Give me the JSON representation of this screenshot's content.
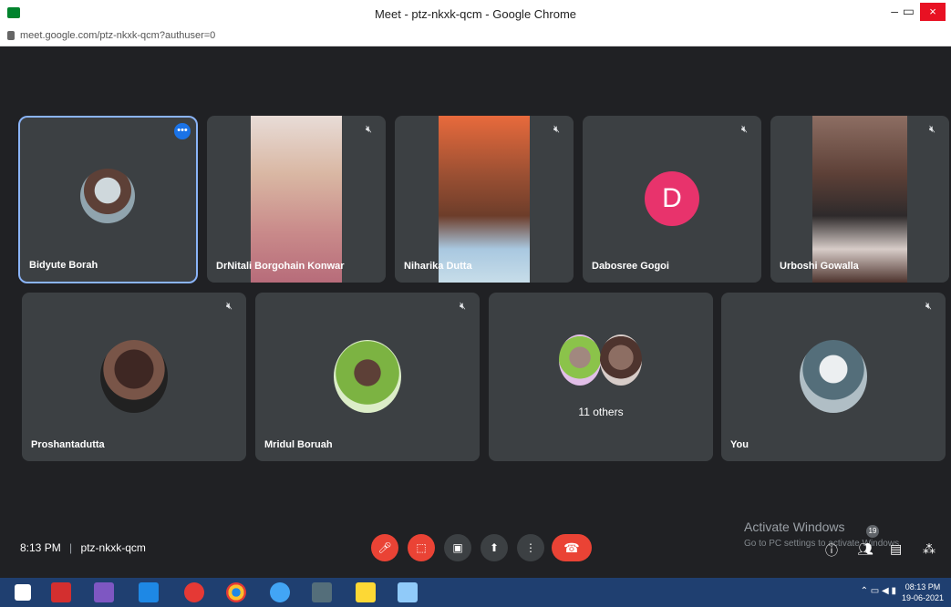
{
  "window": {
    "title": "Meet - ptz-nkxk-qcm - Google Chrome",
    "minimize": "–",
    "restore": "▭",
    "close": "×"
  },
  "address": {
    "url": "meet.google.com/ptz-nkxk-qcm?authuser=0"
  },
  "tiles": [
    {
      "name": "Bidyute Borah",
      "more": "•••"
    },
    {
      "name": "DrNitali Borgohain Konwar"
    },
    {
      "name": "Niharika Dutta"
    },
    {
      "name": "Dabosree Gogoi",
      "initial": "D"
    },
    {
      "name": "Urboshi Gowalla"
    },
    {
      "name": "Proshantadutta"
    },
    {
      "name": "Mridul Boruah"
    },
    {
      "name": "11 others"
    },
    {
      "name": "You"
    }
  ],
  "bottom": {
    "time": "8:13 PM",
    "separator": "|",
    "code": "ptz-nkxk-qcm",
    "participants_count": "19"
  },
  "watermark": {
    "line1": "Activate Windows",
    "line2": "Go to PC settings to activate Windows."
  },
  "taskbar": {
    "time": "08:13 PM",
    "date": "19-06-2021"
  },
  "icons": [
    "mic-off-icon",
    "cam-off-icon",
    "captions-icon",
    "present-icon",
    "more-icon",
    "end-call-icon",
    "info-icon",
    "people-icon",
    "chat-icon",
    "activities-icon"
  ],
  "colors": {
    "accent": "#1a73e8",
    "red": "#ea4335",
    "tile": "#3c4043",
    "bg": "#202124"
  }
}
